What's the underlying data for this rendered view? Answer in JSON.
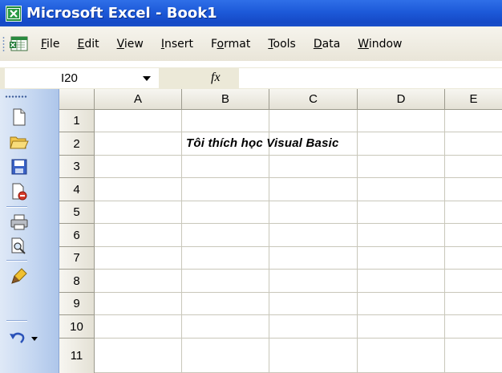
{
  "window": {
    "title": "Microsoft Excel - Book1",
    "app_icon": "excel-icon"
  },
  "menu": {
    "items": [
      {
        "pre": "",
        "ul": "F",
        "post": "ile"
      },
      {
        "pre": "",
        "ul": "E",
        "post": "dit"
      },
      {
        "pre": "",
        "ul": "V",
        "post": "iew"
      },
      {
        "pre": "",
        "ul": "I",
        "post": "nsert"
      },
      {
        "pre": "F",
        "ul": "o",
        "post": "rmat"
      },
      {
        "pre": "",
        "ul": "T",
        "post": "ools"
      },
      {
        "pre": "",
        "ul": "D",
        "post": "ata"
      },
      {
        "pre": "",
        "ul": "W",
        "post": "indow"
      }
    ]
  },
  "formula_bar": {
    "name_box": "I20",
    "fx": "fx",
    "formula": ""
  },
  "toolbar": {
    "buttons": [
      "new-icon",
      "open-icon",
      "save-icon",
      "permission-icon",
      "print-icon",
      "print-preview-icon",
      "format-painter-icon",
      "undo-icon"
    ]
  },
  "sheet": {
    "columns": [
      "A",
      "B",
      "C",
      "D",
      "E"
    ],
    "rows": [
      "1",
      "2",
      "3",
      "4",
      "5",
      "6",
      "7",
      "8",
      "9",
      "10",
      "11"
    ],
    "cell_B2": "Tôi thích học Visual Basic"
  },
  "colors": {
    "titlebar": "#1d5ad9",
    "header_bg": "#ece9d8",
    "gridline": "#c9c7ba",
    "toolbar_bg": "#c5d7f1"
  }
}
